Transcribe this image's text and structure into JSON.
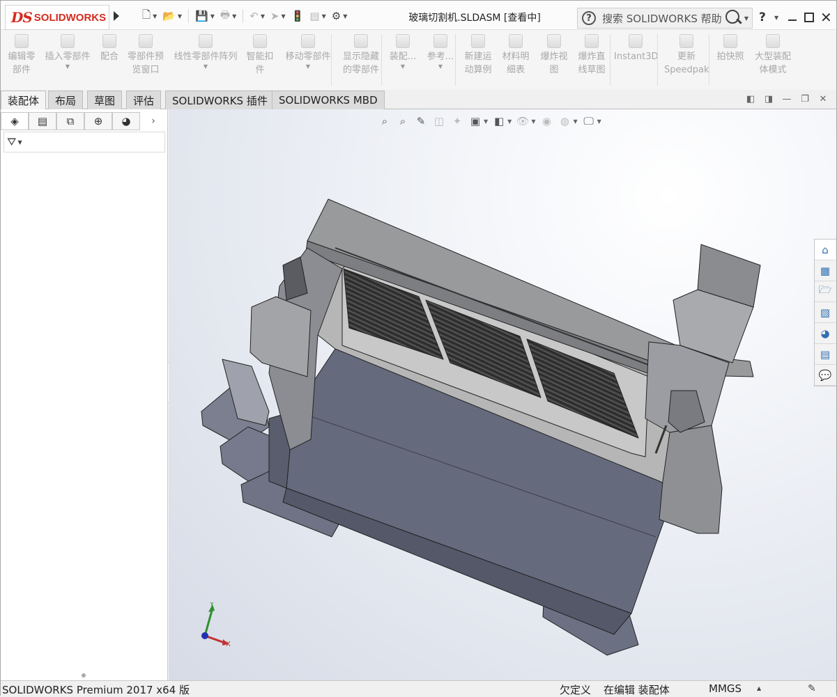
{
  "app": {
    "logo_mark": "DS",
    "logo_text": "SOLIDWORKS",
    "document_title": "玻璃切割机.SLDASM [查看中]"
  },
  "quick_access": [
    {
      "icon": "new-document-icon",
      "glyph": "🗋",
      "caret": true,
      "dim": false
    },
    {
      "icon": "open-icon",
      "glyph": "📂",
      "caret": true,
      "dim": false
    },
    {
      "icon": "save-icon",
      "glyph": "💾",
      "caret": true,
      "dim": true
    },
    {
      "icon": "print-icon",
      "glyph": "🖶",
      "caret": true,
      "dim": true
    },
    {
      "icon": "undo-icon",
      "glyph": "↶",
      "caret": true,
      "dim": true
    },
    {
      "icon": "select-icon",
      "glyph": "➤",
      "caret": true,
      "dim": true
    },
    {
      "icon": "rebuild-icon",
      "glyph": "🚦",
      "caret": false,
      "dim": true
    },
    {
      "icon": "file-properties-icon",
      "glyph": "▤",
      "caret": true,
      "dim": true
    },
    {
      "icon": "options-gear-icon",
      "glyph": "⚙",
      "caret": true,
      "dim": false
    }
  ],
  "search": {
    "placeholder": "搜索 SOLIDWORKS 帮助"
  },
  "help_label": "?",
  "commands": [
    {
      "name": "edit-component",
      "label": "编辑零\n部件",
      "caret": false
    },
    {
      "name": "insert-components",
      "label": "插入零部件",
      "caret": true
    },
    {
      "name": "mate",
      "label": "配合",
      "caret": false
    },
    {
      "name": "component-preview",
      "label": "零部件预\n览窗口",
      "caret": false
    },
    {
      "name": "linear-pattern",
      "label": "线性零部件阵列",
      "caret": true
    },
    {
      "name": "smart-fasteners",
      "label": "智能扣\n件",
      "caret": false
    },
    {
      "name": "move-component",
      "label": "移动零部件",
      "caret": true
    },
    {
      "name": "show-hidden",
      "label": "显示隐藏\n的零部件",
      "caret": false
    },
    {
      "name": "assembly-features",
      "label": "装配...",
      "caret": true
    },
    {
      "name": "reference-geometry",
      "label": "参考...",
      "caret": true
    },
    {
      "name": "new-motion-study",
      "label": "新建运\n动算例",
      "caret": false
    },
    {
      "name": "bill-of-materials",
      "label": "材料明\n细表",
      "caret": false
    },
    {
      "name": "exploded-view",
      "label": "爆炸视\n图",
      "caret": false
    },
    {
      "name": "explode-line-sketch",
      "label": "爆炸直\n线草图",
      "caret": false
    },
    {
      "name": "instant3d",
      "label": "Instant3D",
      "caret": false
    },
    {
      "name": "update-speedpak",
      "label": "更新\nSpeedpak",
      "caret": false
    },
    {
      "name": "take-snapshot",
      "label": "拍快照",
      "caret": false
    },
    {
      "name": "large-assembly-mode",
      "label": "大型装配\n体模式",
      "caret": false
    }
  ],
  "tabs": [
    "装配体",
    "布局",
    "草图",
    "评估",
    "SOLIDWORKS 插件",
    "SOLIDWORKS MBD"
  ],
  "active_tab": 0,
  "fm_tabs": [
    {
      "name": "featuremanager-tree-icon",
      "glyph": "◈"
    },
    {
      "name": "propertymanager-icon",
      "glyph": "▤"
    },
    {
      "name": "configurationmanager-icon",
      "glyph": "⧉"
    },
    {
      "name": "dimxpertmanager-icon",
      "glyph": "⊕"
    },
    {
      "name": "displaymanager-icon",
      "glyph": "◕"
    }
  ],
  "hud": [
    {
      "name": "zoom-to-fit-icon",
      "glyph": "⌕",
      "caret": false,
      "dim": false
    },
    {
      "name": "zoom-to-area-icon",
      "glyph": "⌕",
      "caret": false,
      "dim": false
    },
    {
      "name": "previous-view-icon",
      "glyph": "✎",
      "caret": false,
      "dim": false
    },
    {
      "name": "section-view-icon",
      "glyph": "◫",
      "caret": false,
      "dim": true
    },
    {
      "name": "dynamic-annotation-icon",
      "glyph": "✦",
      "caret": false,
      "dim": true
    },
    {
      "name": "view-orientation-icon",
      "glyph": "▣",
      "caret": true,
      "dim": false
    },
    {
      "name": "display-style-icon",
      "glyph": "◧",
      "caret": true,
      "dim": false
    },
    {
      "name": "hide-show-items-icon",
      "glyph": "👁",
      "caret": true,
      "dim": true
    },
    {
      "name": "edit-appearance-icon",
      "glyph": "◉",
      "caret": false,
      "dim": true
    },
    {
      "name": "apply-scene-icon",
      "glyph": "◍",
      "caret": true,
      "dim": true
    },
    {
      "name": "view-settings-icon",
      "glyph": "🖵",
      "caret": true,
      "dim": false
    }
  ],
  "task_pane": [
    {
      "name": "solidworks-resources-icon",
      "glyph": "⌂"
    },
    {
      "name": "design-library-icon",
      "glyph": "▦"
    },
    {
      "name": "file-explorer-icon",
      "glyph": "🗁"
    },
    {
      "name": "view-palette-icon",
      "glyph": "▧"
    },
    {
      "name": "appearances-scenes-icon",
      "glyph": "◕"
    },
    {
      "name": "custom-properties-icon",
      "glyph": "▤"
    },
    {
      "name": "solidworks-forum-icon",
      "glyph": "💬"
    }
  ],
  "triad": {
    "y": "Y",
    "x": "X"
  },
  "status": {
    "product": "SOLIDWORKS Premium 2017 x64 版",
    "definition": "欠定义",
    "editing": "在编辑 装配体",
    "units": "MMGS"
  },
  "colors": {
    "brand_red": "#d52b1e",
    "model_gray": "#8b8f96",
    "frame_dark": "#6c6f7b"
  }
}
